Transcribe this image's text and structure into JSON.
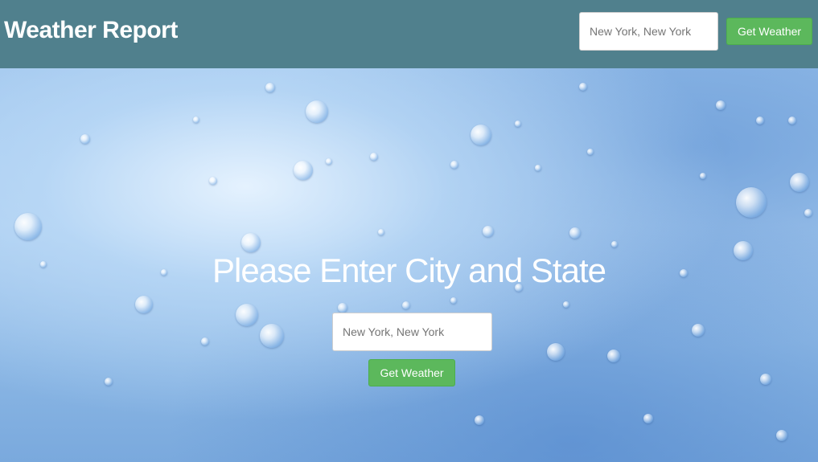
{
  "navbar": {
    "brand": "Weather Report",
    "search_placeholder": "New York, New York",
    "button_label": "Get Weather"
  },
  "hero": {
    "heading": "Please Enter City and State",
    "search_placeholder": "New York, New York",
    "button_label": "Get Weather"
  },
  "colors": {
    "navbar_bg": "#50808d",
    "button_bg": "#5cb85c",
    "text_light": "#ffffff"
  }
}
